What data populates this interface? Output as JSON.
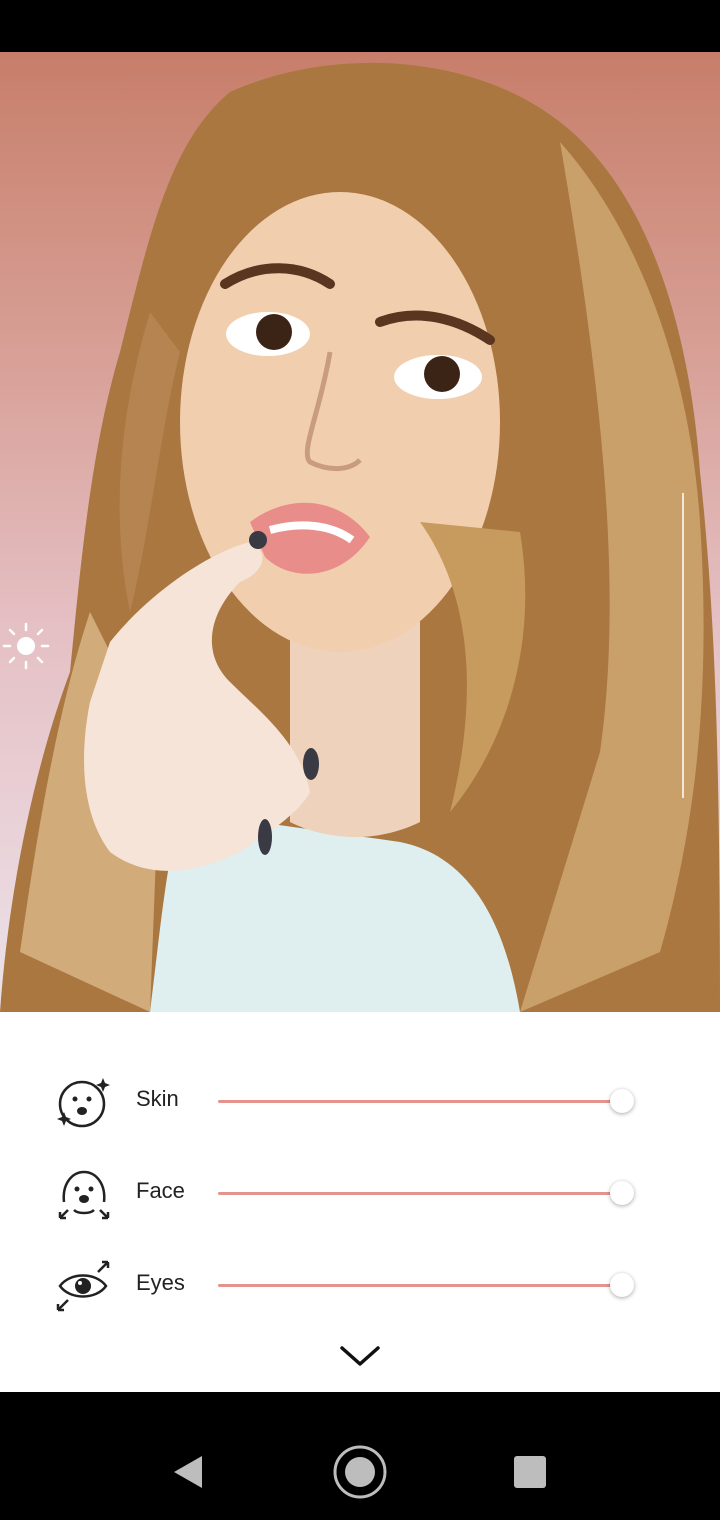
{
  "controls": [
    {
      "label": "Skin",
      "icon": "skin-smoothing-face-icon",
      "level": 1.0
    },
    {
      "label": "Face",
      "icon": "face-slim-icon",
      "level": 1.0
    },
    {
      "label": "Eyes",
      "icon": "eye-enlarge-icon",
      "level": 1.0
    }
  ],
  "exposure": {
    "icon": "sun-icon"
  },
  "collapse": {
    "icon": "chevron-down-icon"
  },
  "navigation": {
    "back_icon": "back-triangle-icon",
    "home_icon": "home-circle-icon",
    "recents_icon": "recents-square-icon"
  },
  "colors": {
    "slider_accent": "#e4948c",
    "panel_background": "#ffffff",
    "system_bar": "#000000"
  }
}
